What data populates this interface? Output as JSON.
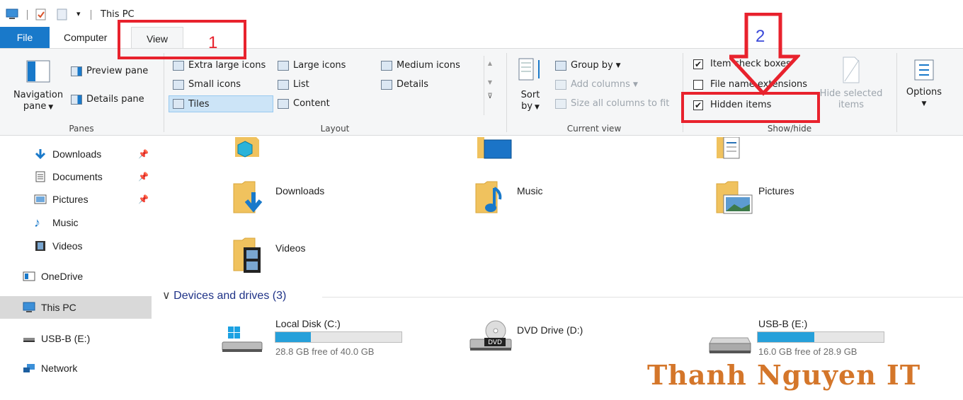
{
  "window": {
    "title": "This PC"
  },
  "tabs": {
    "file": "File",
    "computer": "Computer",
    "view": "View"
  },
  "ribbon": {
    "panes": {
      "navigation_pane": "Navigation",
      "navigation_pane2": "pane",
      "preview_pane": "Preview pane",
      "details_pane": "Details pane",
      "group_label": "Panes"
    },
    "layout": {
      "items": [
        "Extra large icons",
        "Large icons",
        "Medium icons",
        "Small icons",
        "List",
        "Details",
        "Tiles",
        "Content"
      ],
      "selected": "Tiles",
      "group_label": "Layout"
    },
    "current_view": {
      "sort_by": "Sort",
      "sort_by2": "by",
      "group_by": "Group by",
      "add_columns": "Add columns",
      "size_all_columns": "Size all columns to fit",
      "group_label": "Current view"
    },
    "show_hide": {
      "item_check_boxes": {
        "label": "Item check boxes",
        "checked": true
      },
      "file_name_extensions": {
        "label": "File name extensions",
        "checked": false
      },
      "hidden_items": {
        "label": "Hidden items",
        "checked": true
      },
      "hide_selected": "Hide selected",
      "hide_selected2": "items",
      "group_label": "Show/hide"
    },
    "options": {
      "label": "Options"
    }
  },
  "nav": {
    "items": [
      {
        "label": "Downloads",
        "pinned": true
      },
      {
        "label": "Documents",
        "pinned": true
      },
      {
        "label": "Pictures",
        "pinned": true
      },
      {
        "label": "Music",
        "pinned": false
      },
      {
        "label": "Videos",
        "pinned": false
      },
      {
        "label": "OneDrive",
        "pinned": false
      },
      {
        "label": "This PC",
        "pinned": false,
        "selected": true
      },
      {
        "label": "USB-B (E:)",
        "pinned": false
      },
      {
        "label": "Network",
        "pinned": false
      }
    ]
  },
  "folders": [
    "Downloads",
    "Music",
    "Pictures",
    "Videos"
  ],
  "devices": {
    "header": "Devices and drives (3)",
    "drives": [
      {
        "name": "Local Disk (C:)",
        "free": "28.8 GB free of 40.0 GB",
        "used_fraction": 0.28
      },
      {
        "name": "DVD Drive (D:)",
        "free": "",
        "used_fraction": 0
      },
      {
        "name": "USB-B (E:)",
        "free": "16.0 GB free of 28.9 GB",
        "used_fraction": 0.45
      }
    ]
  },
  "annotations": {
    "step1": "1",
    "step2": "2"
  },
  "watermark": "Thanh Nguyen IT",
  "colors": {
    "accent": "#1979ca",
    "annotation_red": "#e8222d",
    "drive_bar": "#26a0da",
    "watermark": "#d4762a"
  }
}
